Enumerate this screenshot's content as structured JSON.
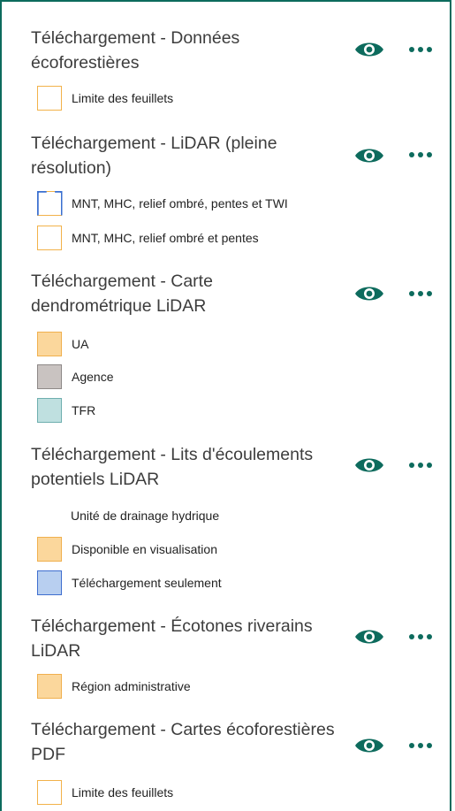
{
  "layers": [
    {
      "title": "Téléchargement - Données écoforestières",
      "legend": [
        {
          "label": "Limite des feuillets",
          "swatch": "outline-orange"
        }
      ]
    },
    {
      "title": "Téléchargement - LiDAR (pleine résolution)",
      "legend": [
        {
          "label": "MNT, MHC, relief ombré, pentes et TWI",
          "swatch": "outline-blue"
        },
        {
          "label": "MNT, MHC, relief ombré et pentes",
          "swatch": "outline-orange"
        }
      ]
    },
    {
      "title": "Téléchargement - Carte dendrométrique LiDAR",
      "legend": [
        {
          "label": "UA",
          "swatch": "fill-orange"
        },
        {
          "label": "Agence",
          "swatch": "fill-grey"
        },
        {
          "label": "TFR",
          "swatch": "fill-teal"
        }
      ]
    },
    {
      "title": "Téléchargement - Lits d'écoulements potentiels LiDAR",
      "legend": [
        {
          "label": "Unité de drainage hydrique",
          "swatch": "none"
        },
        {
          "label": "Disponible en visualisation",
          "swatch": "fill-orange"
        },
        {
          "label": "Téléchargement seulement",
          "swatch": "fill-blue"
        }
      ]
    },
    {
      "title": "Téléchargement - Écotones riverains LiDAR",
      "legend": [
        {
          "label": "Région administrative",
          "swatch": "fill-orange"
        }
      ]
    },
    {
      "title": "Téléchargement - Cartes écoforestières PDF",
      "legend": [
        {
          "label": "Limite des feuillets",
          "swatch": "outline-orange"
        }
      ]
    }
  ],
  "icons": {
    "visibility": "eye-icon",
    "options": "more-horizontal-icon"
  },
  "colors": {
    "accent": "#0d6b5d",
    "panel_border": "#0d6b5d",
    "swatch_orange": "#fbd79c",
    "swatch_orange_border": "#f0b04e",
    "swatch_grey": "#c9c3c1",
    "swatch_teal": "#bfe0e0",
    "swatch_blue": "#b8cff0",
    "swatch_blue_border": "#3f6ecf"
  }
}
